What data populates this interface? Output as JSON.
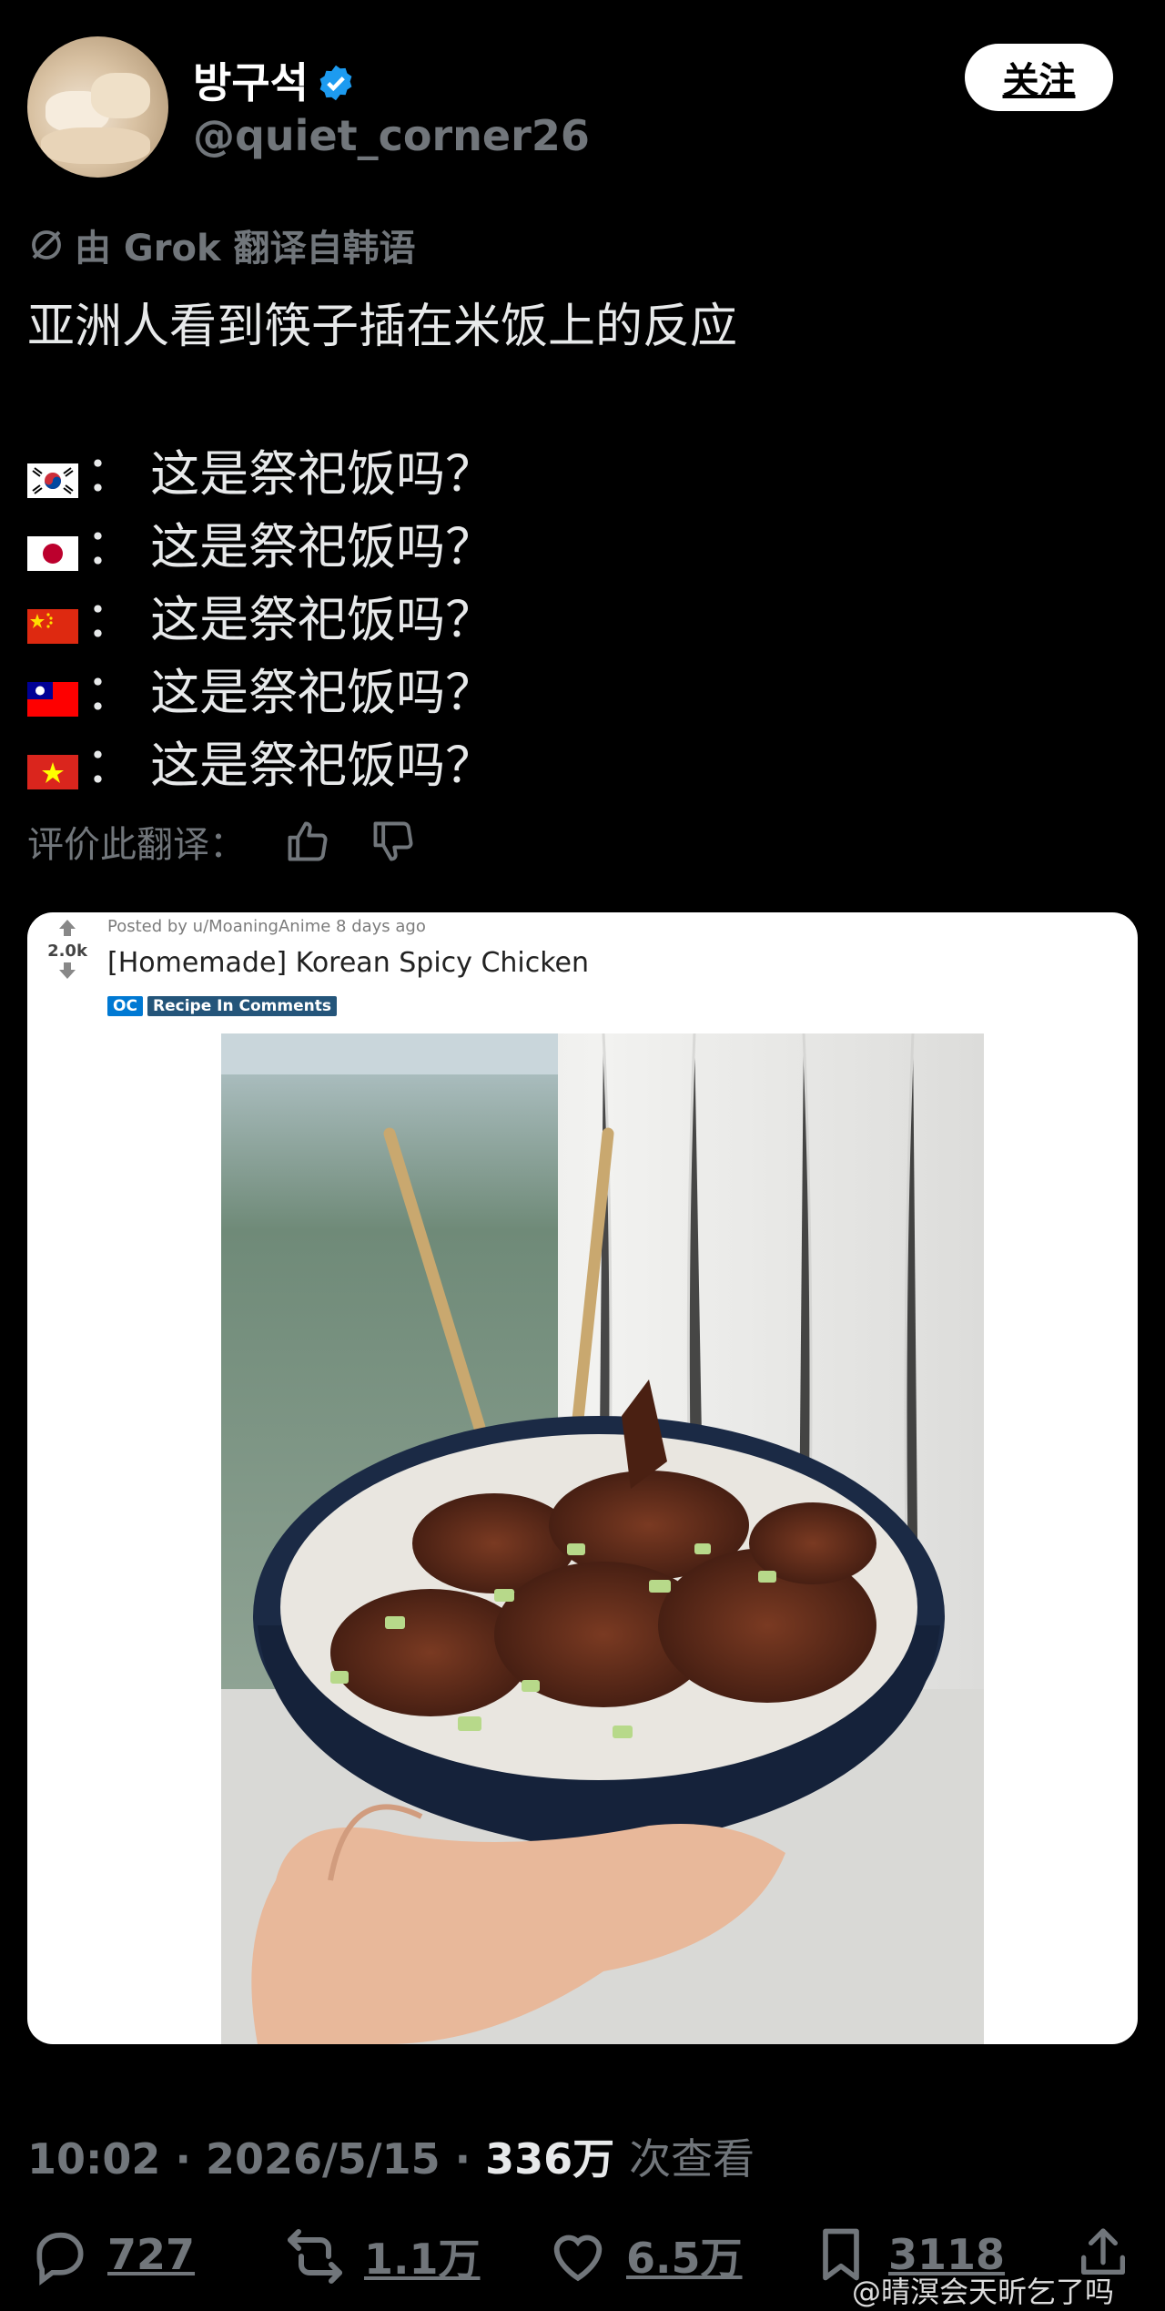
{
  "author": {
    "display_name": "방구석",
    "handle": "@quiet_corner26",
    "verified": true,
    "follow_label": "关注"
  },
  "translation_note": "由 Grok 翻译自韩语",
  "tweet_text": "亚洲人看到筷子插在米饭上的反应",
  "reactions": [
    {
      "flag": "south-korea-flag",
      "text": "：  这是祭祀饭吗？"
    },
    {
      "flag": "japan-flag",
      "text": "：  这是祭祀饭吗？"
    },
    {
      "flag": "china-flag",
      "text": "：  这是祭祀饭吗？"
    },
    {
      "flag": "taiwan-flag",
      "text": "：  这是祭祀饭吗？"
    },
    {
      "flag": "vietnam-flag",
      "text": "：  这是祭祀饭吗？"
    }
  ],
  "rate_translation_label": "评价此翻译：",
  "reddit_card": {
    "vote_count": "2.0k",
    "posted_by": "Posted by u/MoaningAnime 8 days ago",
    "title": "[Homemade] Korean Spicy Chicken",
    "flairs": [
      "OC",
      "Recipe In Comments"
    ]
  },
  "meta": {
    "time": "10:02",
    "date": "2026/5/15",
    "views": "336万",
    "views_label": "次查看"
  },
  "stats": {
    "replies": "727",
    "reposts": "1.1万",
    "likes": "6.5万",
    "bookmarks": "3118"
  },
  "watermark": "@晴溟会天昕乞了吗",
  "colors": {
    "background": "#000000",
    "primary_text": "#e7e9ea",
    "secondary_text": "#71767b",
    "verified_blue": "#1d9bf0",
    "flair_blue": "#0079d3"
  }
}
